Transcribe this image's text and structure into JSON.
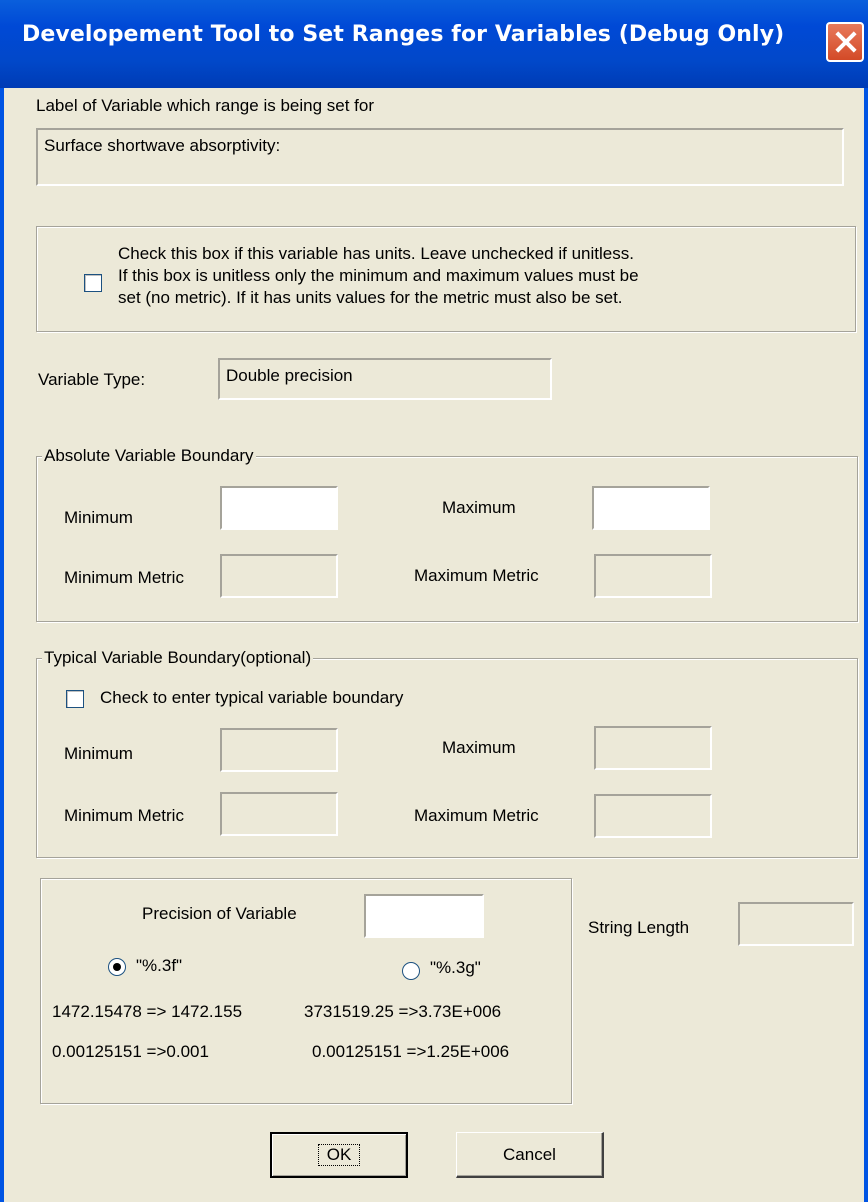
{
  "window": {
    "title": "Developement Tool to Set Ranges for Variables (Debug Only)"
  },
  "label_section": {
    "caption": "Label of Variable which range  is being set for",
    "value": "Surface shortwave absorptivity:"
  },
  "units": {
    "checked": false,
    "line1": "Check this box if this variable has units.  Leave unchecked if unitless.",
    "line2": "If this box is unitless only the minimum and maximum values must be",
    "line3": "set (no metric).  If it has units values for the metric must also be set."
  },
  "variable_type": {
    "label": "Variable Type:",
    "value": "Double precision"
  },
  "absolute": {
    "title": "Absolute Variable Boundary",
    "minimum_label": "Minimum",
    "maximum_label": "Maximum",
    "min_metric_label": "Minimum Metric",
    "max_metric_label": "Maximum Metric",
    "minimum": "",
    "maximum": "",
    "min_metric": "",
    "max_metric": ""
  },
  "typical": {
    "title": "Typical Variable Boundary(optional)",
    "check_label": "Check to enter typical variable  boundary",
    "checked": false,
    "minimum_label": "Minimum",
    "maximum_label": "Maximum",
    "min_metric_label": "Minimum Metric",
    "max_metric_label": "Maximum Metric",
    "minimum": "",
    "maximum": "",
    "min_metric": "",
    "max_metric": ""
  },
  "precision": {
    "label": "Precision of Variable",
    "value": "",
    "option_f": "\"%.3f\"",
    "option_g": "\"%.3g\"",
    "selected": "%.3f",
    "example_f1": "1472.15478 => 1472.155",
    "example_g1": "3731519.25 =>3.73E+006",
    "example_f2": "0.00125151 =>0.001",
    "example_g2": "0.00125151 =>1.25E+006"
  },
  "string_length": {
    "label": "String Length",
    "value": ""
  },
  "buttons": {
    "ok": "OK",
    "cancel": "Cancel"
  },
  "colors": {
    "titlebar": "#0054e3",
    "face": "#ece9d8",
    "close": "#d34a27"
  },
  "icons": {
    "close": "close-icon"
  }
}
